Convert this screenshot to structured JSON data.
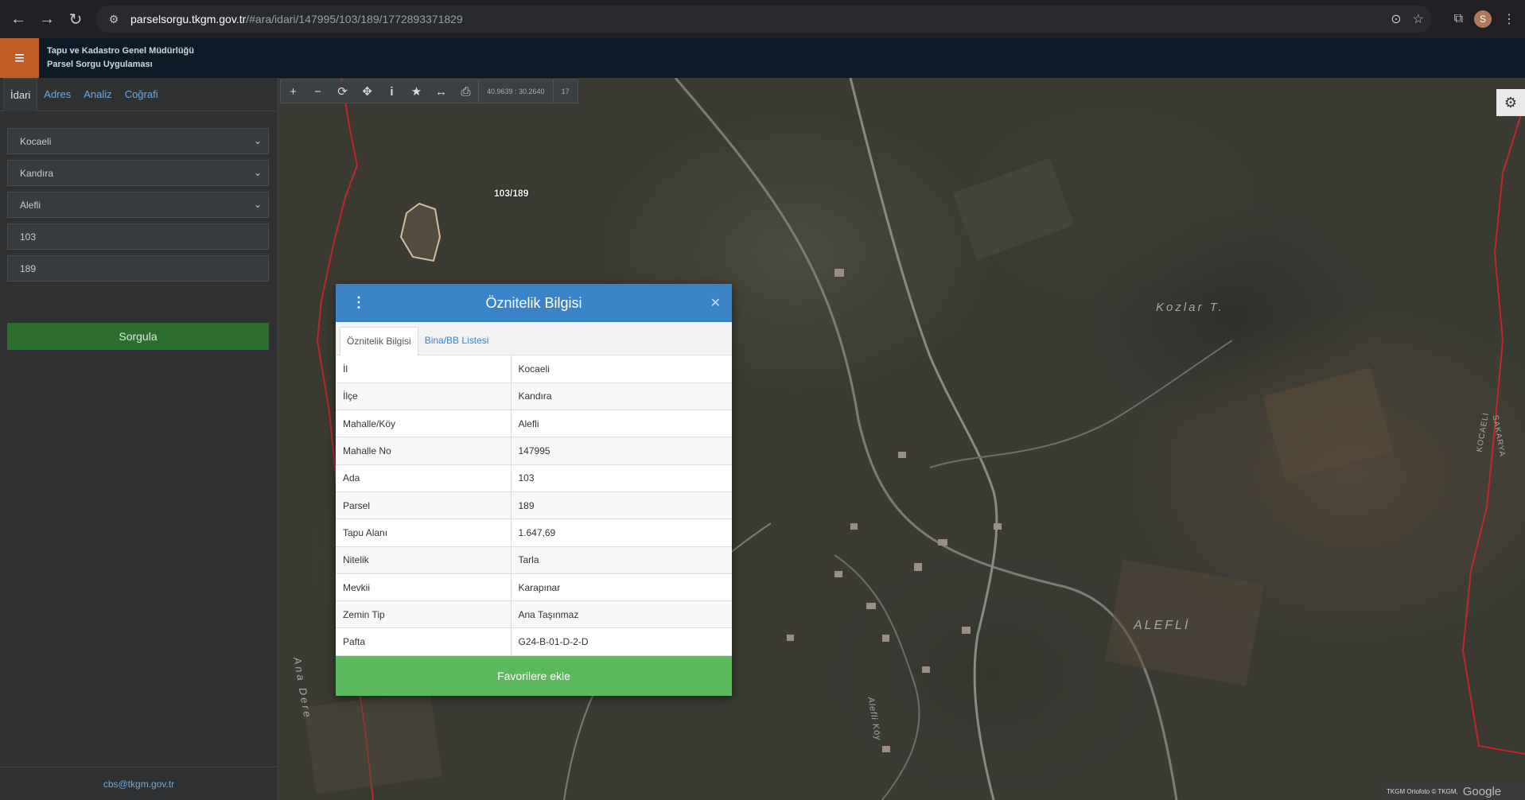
{
  "browser": {
    "url_host": "parselsorgu.tkgm.gov.tr",
    "url_path": "/#ara/idari/147995/103/189/1772893371829",
    "profile_initial": "S"
  },
  "header": {
    "org_name": "Tapu ve Kadastro Genel Müdürlüğü",
    "app_name": "Parsel Sorgu Uygulaması"
  },
  "sidebar": {
    "tabs": [
      "İdari",
      "Adres",
      "Analiz",
      "Coğrafi"
    ],
    "il": "Kocaeli",
    "ilce": "Kandıra",
    "mahalle": "Alefli",
    "ada": "103",
    "parsel": "189",
    "submit_label": "Sorgula",
    "footer_email": "cbs@tkgm.gov.tr"
  },
  "map": {
    "coordinates": "40.9639 : 30.2640",
    "zoom_level": "17",
    "parcel_label": "103/189",
    "place_labels": [
      "Kozlar T.",
      "ALEFLİ",
      "Ana Dere",
      "Alefli Köy",
      "KOCAELİ",
      "SAKARYA"
    ],
    "attribution": "TKGM Ortofoto © TKGM,",
    "google": "Google",
    "icons": [
      "plus-icon",
      "minus-icon",
      "refresh-icon",
      "crosshair-icon",
      "info-icon",
      "star-icon",
      "measure-icon",
      "print-icon",
      "gear-icon"
    ]
  },
  "modal": {
    "title": "Öznitelik Bilgisi",
    "tabs": [
      "Öznitelik Bilgisi",
      "Bina/BB Listesi"
    ],
    "rows": [
      {
        "key": "İl",
        "value": "Kocaeli"
      },
      {
        "key": "İlçe",
        "value": "Kandıra"
      },
      {
        "key": "Mahalle/Köy",
        "value": "Alefli"
      },
      {
        "key": "Mahalle No",
        "value": "147995"
      },
      {
        "key": "Ada",
        "value": "103"
      },
      {
        "key": "Parsel",
        "value": "189"
      },
      {
        "key": "Tapu Alanı",
        "value": "1.647,69"
      },
      {
        "key": "Nitelik",
        "value": "Tarla"
      },
      {
        "key": "Mevkii",
        "value": "Karapınar"
      },
      {
        "key": "Zemin Tip",
        "value": "Ana Taşınmaz"
      },
      {
        "key": "Pafta",
        "value": "G24-B-01-D-2-D"
      }
    ],
    "favorite_label": "Favorilere ekle"
  },
  "colors": {
    "header_bg": "#0c1a27",
    "hamburger_bg": "#c15a25",
    "modal_header": "#3a83c7",
    "favorite_button": "#5cb85c",
    "submit_button": "#2c6e2c",
    "boundary_red": "#c0282b"
  }
}
